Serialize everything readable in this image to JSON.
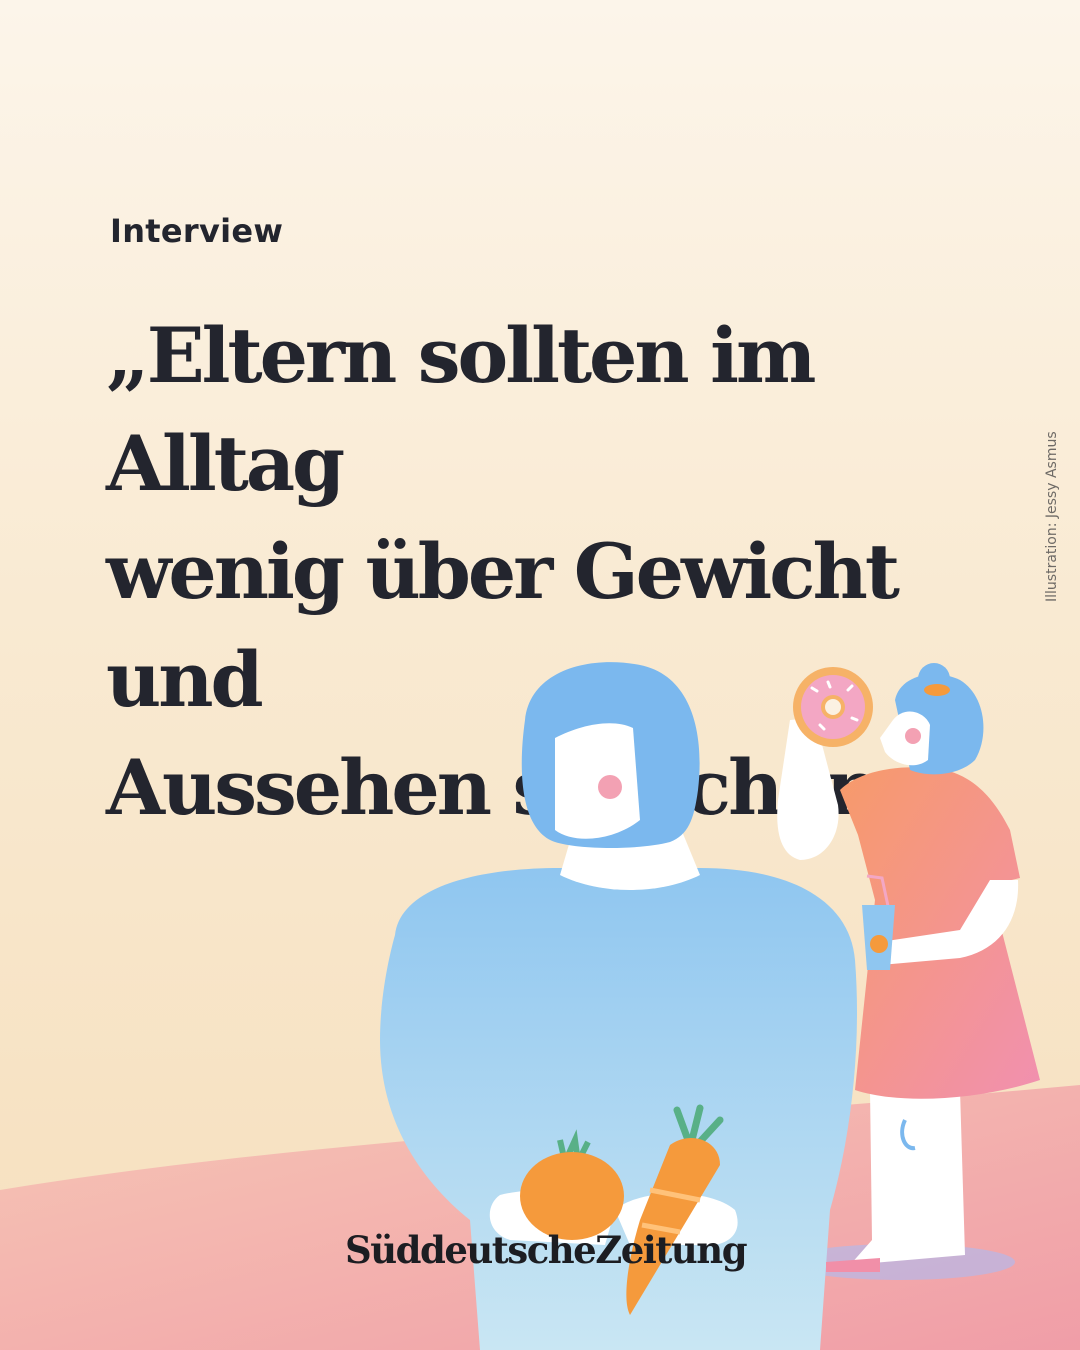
{
  "post": {
    "kicker": "Interview",
    "headline_lines": [
      "„Eltern sollten im Alltag",
      "wenig über Gewicht und",
      "Aussehen sprechen.“"
    ],
    "illustration_credit": "Illustration: Jessy Asmus",
    "publisher_logo": "SüddeutscheZeitung"
  },
  "colors": {
    "background_top": "#fcf5ea",
    "background_bottom": "#f6dfbd",
    "text": "#23252e",
    "ground": "#f2a7ae",
    "hair_blue": "#7bb8ee",
    "sweater_blue": "#a9d4f1",
    "dress": "#f4978a",
    "vegetable_orange": "#f59a3c"
  },
  "illustration": {
    "icons": [
      "adult-figure-icon",
      "child-figure-icon",
      "donut-icon",
      "juice-cup-icon",
      "orange-fruit-icon",
      "carrot-icon"
    ]
  }
}
